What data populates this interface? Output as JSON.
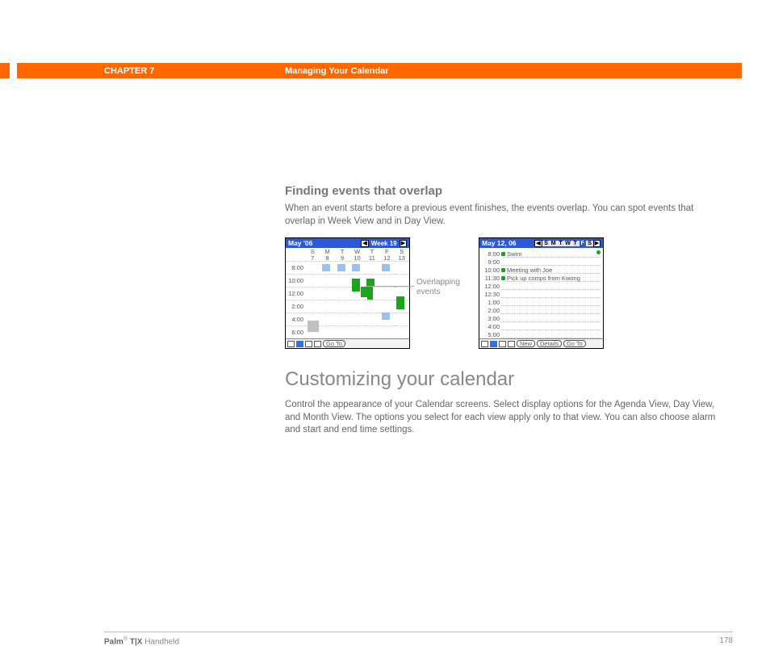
{
  "header": {
    "chapter": "CHAPTER 7",
    "title": "Managing Your Calendar"
  },
  "section1": {
    "title": "Finding events that overlap",
    "body": "When an event starts before a previous event finishes, the events overlap. You can spot events that overlap in Week View and in Day View."
  },
  "overlap_label_line1": "Overlapping",
  "overlap_label_line2": "events",
  "week_view": {
    "month_label": "May '06",
    "week_label": "Week 19",
    "day_letters": [
      "S",
      "M",
      "T",
      "W",
      "T",
      "F",
      "S"
    ],
    "day_nums": [
      "7",
      "8",
      "9",
      "10",
      "11",
      "12",
      "13"
    ],
    "times": [
      "8:00",
      "10:00",
      "12:00",
      "2:00",
      "4:00",
      "6:00"
    ],
    "goto": "Go To"
  },
  "day_view": {
    "date_label": "May 12, 06",
    "day_letters": [
      "S",
      "M",
      "T",
      "W",
      "T",
      "F",
      "S"
    ],
    "rows": [
      {
        "t": "8:00",
        "txt": "Swim",
        "dot": true
      },
      {
        "t": "9:00",
        "txt": "",
        "dot": false
      },
      {
        "t": "10:00",
        "txt": "Meeting with Joe",
        "dot": true
      },
      {
        "t": "11:30",
        "txt": "Pick up comps from Kwong",
        "dot": true
      },
      {
        "t": "12:00",
        "txt": "",
        "dot": false
      },
      {
        "t": "12:30",
        "txt": "",
        "dot": false
      },
      {
        "t": "1:00",
        "txt": "",
        "dot": false
      },
      {
        "t": "2:00",
        "txt": "",
        "dot": false
      },
      {
        "t": "3:00",
        "txt": "",
        "dot": false
      },
      {
        "t": "4:00",
        "txt": "",
        "dot": false
      },
      {
        "t": "5:00",
        "txt": "",
        "dot": false
      }
    ],
    "new_btn": "New",
    "details_btn": "Details",
    "goto": "Go To"
  },
  "section2": {
    "title": "Customizing your calendar",
    "body": "Control the appearance of your Calendar screens. Select display options for the Agenda View, Day View, and Month View. The options you select for each view apply only to that view. You can also choose alarm and start and end time settings."
  },
  "footer": {
    "product_bold": "Palm",
    "product_reg": "®",
    "product_model": " T|X",
    "product_tail": " Handheld",
    "page": "178"
  }
}
